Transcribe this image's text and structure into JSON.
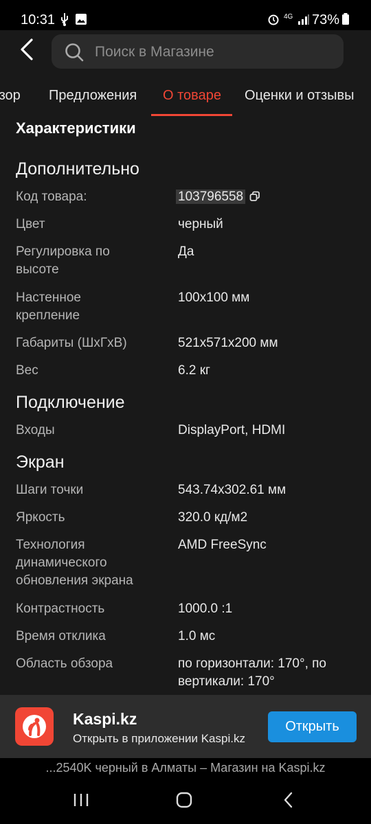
{
  "status": {
    "time": "10:31",
    "battery": "73%",
    "network": "4G"
  },
  "search": {
    "placeholder": "Поиск в Магазине"
  },
  "tabs": [
    {
      "label": "Обзор"
    },
    {
      "label": "Предложения"
    },
    {
      "label": "О товаре"
    },
    {
      "label": "Оценки и отзывы"
    }
  ],
  "section_title": "Характеристики",
  "groups": {
    "extra": {
      "title": "Дополнительно",
      "rows": [
        {
          "label": "Код товара:",
          "value": "103796558"
        },
        {
          "label": "Цвет",
          "value": "черный"
        },
        {
          "label": "Регулировка по высоте",
          "value": "Да"
        },
        {
          "label": "Настенное крепление",
          "value": "100x100 мм"
        },
        {
          "label": "Габариты (ШхГхВ)",
          "value": "521x571x200 мм"
        },
        {
          "label": "Вес",
          "value": "6.2 кг"
        }
      ]
    },
    "connection": {
      "title": "Подключение",
      "rows": [
        {
          "label": "Входы",
          "value": "DisplayPort, HDMI"
        }
      ]
    },
    "screen": {
      "title": "Экран",
      "rows": [
        {
          "label": "Шаги точки",
          "value": "543.74x302.61 мм"
        },
        {
          "label": "Яркость",
          "value": "320.0 кд/м2"
        },
        {
          "label": "Технология динамического обновления экрана",
          "value": "AMD FreeSync"
        },
        {
          "label": "Контрастность",
          "value": "1000.0 :1"
        },
        {
          "label": "Время отклика",
          "value": "1.0 мс"
        },
        {
          "label": "Область обзора",
          "value": "по горизонтали: 170°, по вертикали: 170°"
        }
      ]
    }
  },
  "banner": {
    "title": "Kaspi.kz",
    "subtitle": "Открыть в приложении Kaspi.kz",
    "button": "Открыть"
  },
  "url_text": "...2540K черный в Алматы – Магазин на Kaspi.kz",
  "colors": {
    "accent": "#f14635",
    "button_blue": "#1a8fde",
    "background": "#191919"
  }
}
